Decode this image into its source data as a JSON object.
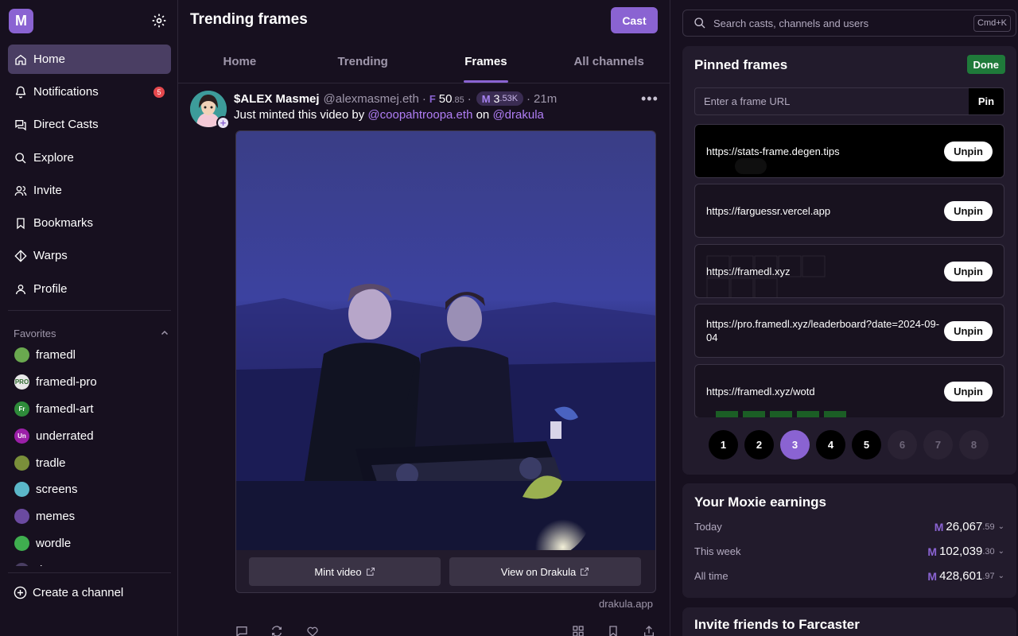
{
  "app": {
    "logo_letter": "M"
  },
  "sidebar": {
    "nav": [
      {
        "label": "Home",
        "icon": "home-icon",
        "active": true
      },
      {
        "label": "Notifications",
        "icon": "bell-icon",
        "badge": "5"
      },
      {
        "label": "Direct Casts",
        "icon": "chat-icon"
      },
      {
        "label": "Explore",
        "icon": "search-icon"
      },
      {
        "label": "Invite",
        "icon": "users-icon"
      },
      {
        "label": "Bookmarks",
        "icon": "bookmark-icon"
      },
      {
        "label": "Warps",
        "icon": "diamond-icon"
      },
      {
        "label": "Profile",
        "icon": "user-icon"
      }
    ],
    "favorites_label": "Favorites",
    "favorites": [
      {
        "label": "framedl",
        "color": "#6aa84f",
        "abbr": ""
      },
      {
        "label": "framedl-pro",
        "color": "#e8e8e8",
        "abbr": "PRO"
      },
      {
        "label": "framedl-art",
        "color": "#2e8b3a",
        "abbr": "Fr"
      },
      {
        "label": "underrated",
        "color": "#9b1fa8",
        "abbr": "Un"
      },
      {
        "label": "tradle",
        "color": "#7a8f3a",
        "abbr": ""
      },
      {
        "label": "screens",
        "color": "#5bb7c9",
        "abbr": ""
      },
      {
        "label": "memes",
        "color": "#6b4aa0",
        "abbr": ""
      },
      {
        "label": "wordle",
        "color": "#3fae4f",
        "abbr": ""
      },
      {
        "label": "d",
        "color": "#4a3e63",
        "abbr": ""
      }
    ],
    "create_channel": "Create a channel"
  },
  "main": {
    "title": "Trending frames",
    "cast_button": "Cast",
    "tabs": [
      {
        "label": "Home"
      },
      {
        "label": "Trending"
      },
      {
        "label": "Frames",
        "active": true
      },
      {
        "label": "All channels"
      }
    ],
    "post": {
      "display_name": "$ALEX Masmej",
      "username": "@alexmasmej.eth",
      "score_main": "50",
      "score_decimal": ".85",
      "moxie_main": "3",
      "moxie_decimal": ".53K",
      "time": "21m",
      "text_before": "Just minted this video by ",
      "mention_1": "@coopahtroopa.eth",
      "text_middle": " on ",
      "mention_2": "@drakula",
      "frame_buttons": [
        "Mint video",
        "View on Drakula"
      ],
      "frame_domain": "drakula.app"
    }
  },
  "right": {
    "search": {
      "placeholder": "Search casts, channels and users",
      "shortcut": "Cmd+K"
    },
    "pinned": {
      "title": "Pinned frames",
      "done_button": "Done",
      "url_placeholder": "Enter a frame URL",
      "pin_button": "Pin",
      "unpin_label": "Unpin",
      "frames": [
        {
          "url": "https://stats-frame.degen.tips"
        },
        {
          "url": "https://farguessr.vercel.app"
        },
        {
          "url": "https://framedl.xyz"
        },
        {
          "url": "https://pro.framedl.xyz/leaderboard?date=2024-09-04"
        },
        {
          "url": "https://framedl.xyz/wotd"
        }
      ],
      "pages": [
        "1",
        "2",
        "3",
        "4",
        "5",
        "6",
        "7",
        "8"
      ],
      "current_page": "3"
    },
    "moxie": {
      "title": "Your Moxie earnings",
      "rows": [
        {
          "label": "Today",
          "main": "26,067",
          "decimal": ".59"
        },
        {
          "label": "This week",
          "main": "102,039",
          "decimal": ".30"
        },
        {
          "label": "All time",
          "main": "428,601",
          "decimal": ".97"
        }
      ]
    },
    "invite": {
      "title": "Invite friends to Farcaster"
    }
  }
}
